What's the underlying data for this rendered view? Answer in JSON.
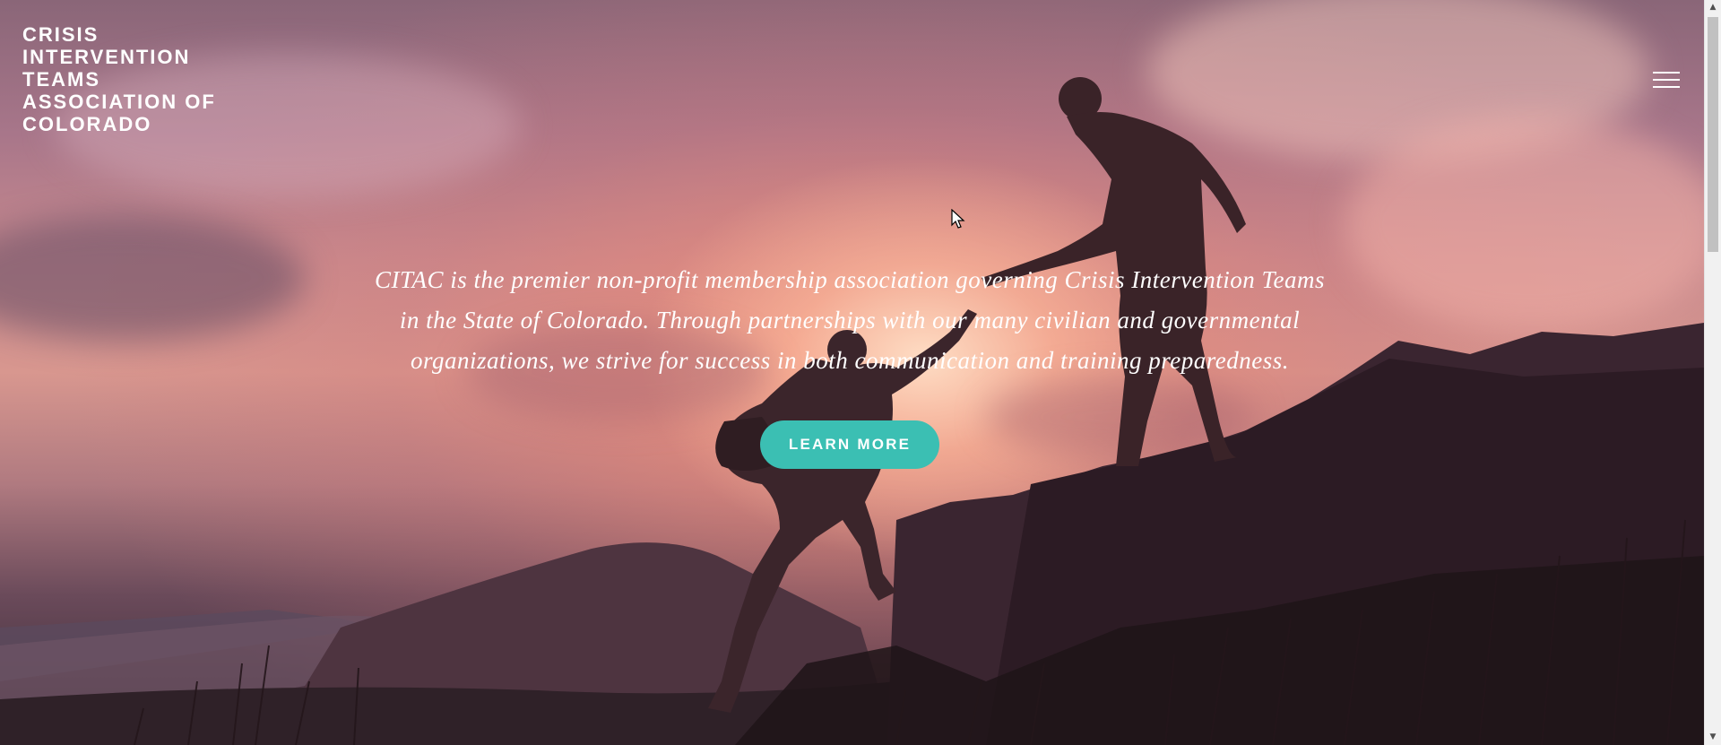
{
  "site": {
    "title": "CRISIS INTERVENTION TEAMS ASSOCIATION OF COLORADO",
    "menu_icon": "hamburger-menu-icon"
  },
  "hero": {
    "tagline": "CITAC is the premier non-profit membership association governing Crisis Intervention Teams in the State of Colorado. Through partnerships with our many civilian and governmental organizations, we strive for success in both communication and training preparedness.",
    "cta_label": "LEARN MORE"
  },
  "colors": {
    "cta_background": "#3bbfb3",
    "text": "#ffffff"
  },
  "scrollbar": {
    "up_icon": "▲",
    "down_icon": "▼"
  }
}
